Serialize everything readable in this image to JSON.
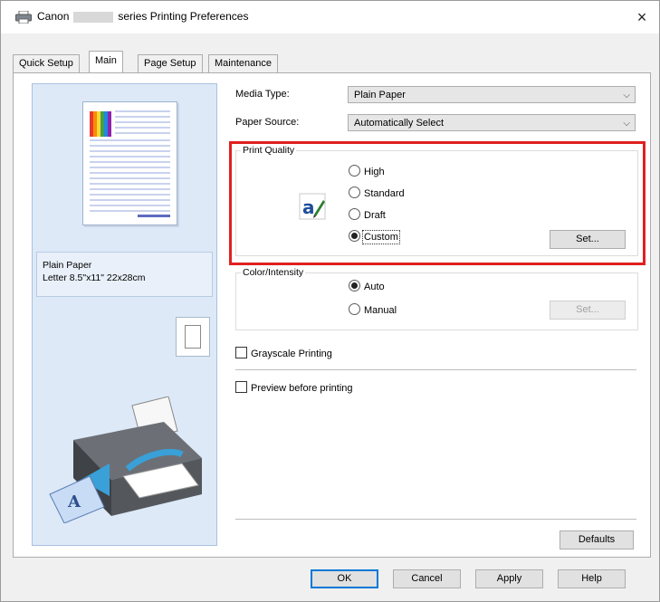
{
  "window": {
    "title_brand": "Canon",
    "title_suffix": "series Printing Preferences",
    "close_label": "×"
  },
  "tabs": [
    {
      "label": "Quick Setup",
      "active": false
    },
    {
      "label": "Main",
      "active": true
    },
    {
      "label": "Page Setup",
      "active": false
    },
    {
      "label": "Maintenance",
      "active": false
    }
  ],
  "preview": {
    "paper_type": "Plain Paper",
    "paper_size": "Letter 8.5\"x11\" 22x28cm"
  },
  "media_type": {
    "label": "Media Type:",
    "value": "Plain Paper"
  },
  "paper_source": {
    "label": "Paper Source:",
    "value": "Automatically Select"
  },
  "print_quality": {
    "title": "Print Quality",
    "options": [
      {
        "label": "High",
        "checked": false
      },
      {
        "label": "Standard",
        "checked": false
      },
      {
        "label": "Draft",
        "checked": false
      },
      {
        "label": "Custom",
        "checked": true
      }
    ],
    "set_label": "Set..."
  },
  "color_intensity": {
    "title": "Color/Intensity",
    "options": [
      {
        "label": "Auto",
        "checked": true
      },
      {
        "label": "Manual",
        "checked": false
      }
    ],
    "set_label": "Set..."
  },
  "grayscale": {
    "label": "Grayscale Printing",
    "checked": false
  },
  "preview_before": {
    "label": "Preview before printing",
    "checked": false
  },
  "defaults_label": "Defaults",
  "footer": {
    "ok": "OK",
    "cancel": "Cancel",
    "apply": "Apply",
    "help": "Help"
  },
  "colors": {
    "highlight": "#e02020",
    "preview_bg": "#dde9f7",
    "focus_blue": "#0078d7"
  }
}
